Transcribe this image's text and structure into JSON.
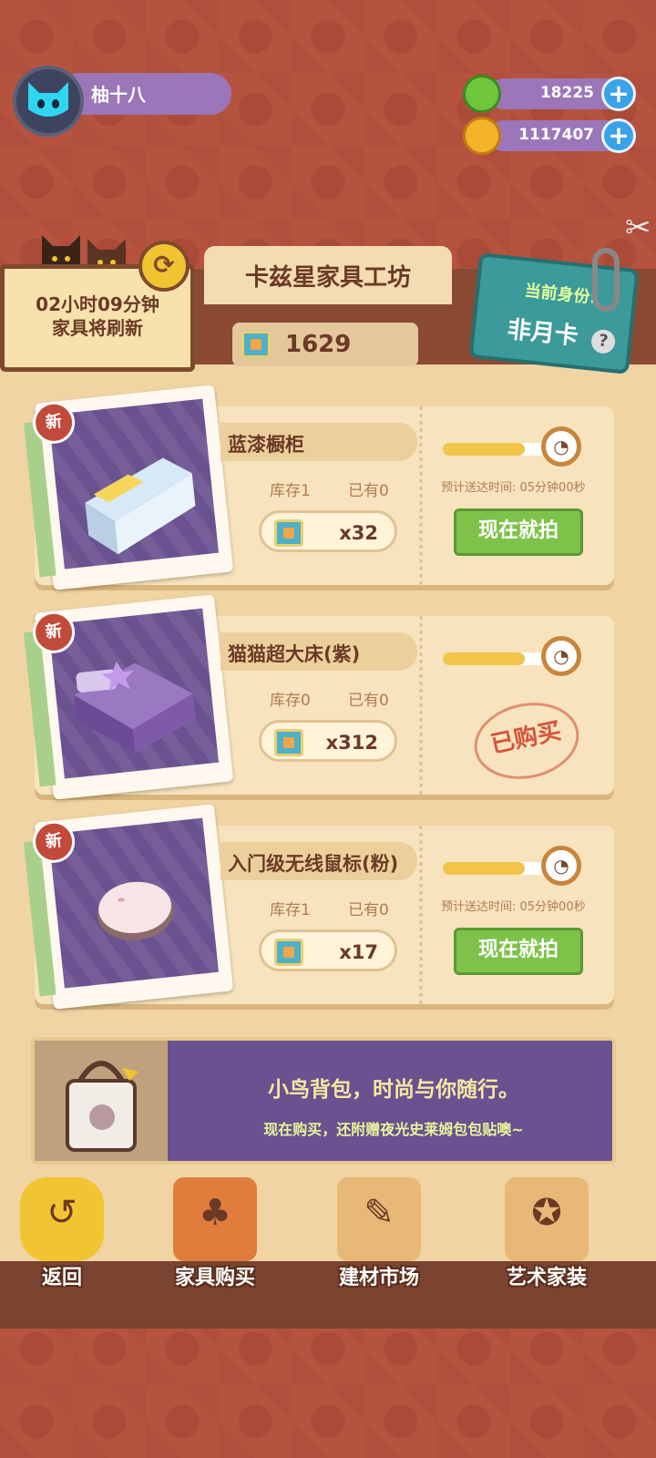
{
  "user": {
    "name": "柚十八"
  },
  "currencies": [
    {
      "name": "green-gem",
      "value": "18225",
      "color": "#6ec63c"
    },
    {
      "name": "gold-coin",
      "value": "1117407",
      "color": "#f3b42c"
    }
  ],
  "refresh": {
    "line1": "02小时09分钟",
    "line2": "家具将刷新"
  },
  "shop_title": "卡兹星家具工坊",
  "points": "1629",
  "identity": {
    "label": "当前身份:",
    "value": "非月卡",
    "help": "?"
  },
  "items": [
    {
      "badge": "新",
      "name": "蓝漆橱柜",
      "stock": "库存1",
      "owned": "已有0",
      "price": "x32",
      "progress": 0.75,
      "eta": "预计送达时间: 05分钟00秒",
      "action": "现在就拍",
      "purchased": false
    },
    {
      "badge": "新",
      "name": "猫猫超大床(紫)",
      "stock": "库存0",
      "owned": "已有0",
      "price": "x312",
      "progress": 0.75,
      "eta": "",
      "action": "已购买",
      "purchased": true
    },
    {
      "badge": "新",
      "name": "入门级无线鼠标(粉)",
      "stock": "库存1",
      "owned": "已有0",
      "price": "x17",
      "progress": 0.75,
      "eta": "预计送达时间: 05分钟00秒",
      "action": "现在就拍",
      "purchased": false
    }
  ],
  "banner": {
    "line1": "小鸟背包，时尚与你随行。",
    "line2": "现在购买，还附赠夜光史莱姆包包贴噢~"
  },
  "nav": [
    {
      "label": "返回",
      "icon": "back-icon"
    },
    {
      "label": "家具购买",
      "icon": "furniture-icon"
    },
    {
      "label": "建材市场",
      "icon": "brush-icon"
    },
    {
      "label": "艺术家装",
      "icon": "star-icon"
    }
  ]
}
